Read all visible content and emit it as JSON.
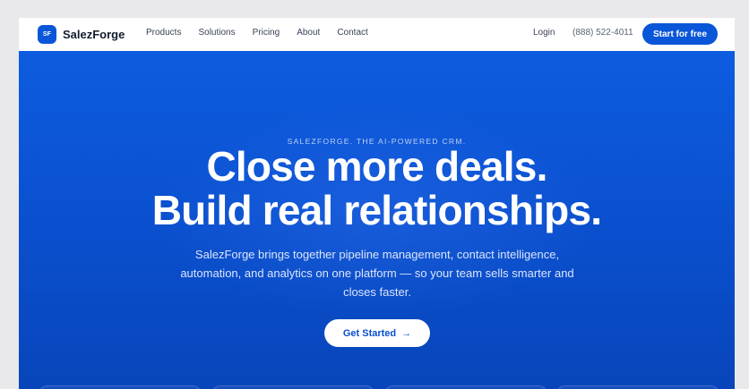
{
  "brand": {
    "logo_mark": "SF",
    "name": "SalezForge",
    "accent_color": "#0a56d8"
  },
  "nav": {
    "links": [
      "Products",
      "Solutions",
      "Pricing",
      "About",
      "Contact"
    ],
    "login": "Login",
    "phone": "(888) 522-4011",
    "cta": "Start for free"
  },
  "hero": {
    "eyebrow": "SALEZFORGE. THE AI-POWERED CRM.",
    "headline_line1": "Close more deals.",
    "headline_line2": "Build real relationships.",
    "subtext": "SalezForge brings together pipeline management, contact intelligence, automation, and analytics on one platform — so your team sells smarter and closes faster.",
    "button": "Get Started",
    "button_icon": "arrow-right-icon",
    "background_color": "#0a4fcd"
  }
}
